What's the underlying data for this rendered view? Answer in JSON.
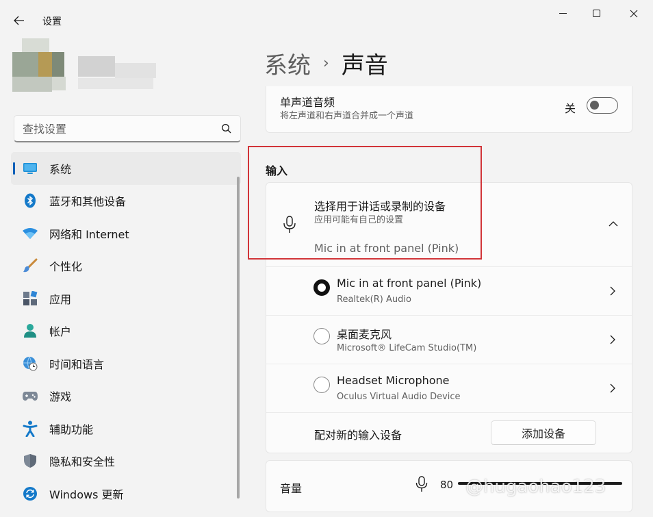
{
  "window": {
    "title": "设置"
  },
  "search": {
    "placeholder": "查找设置"
  },
  "sidebar": {
    "items": [
      {
        "label": "系统",
        "icon": "monitor-icon",
        "selected": true
      },
      {
        "label": "蓝牙和其他设备",
        "icon": "bluetooth-icon"
      },
      {
        "label": "网络和 Internet",
        "icon": "wifi-icon"
      },
      {
        "label": "个性化",
        "icon": "paintbrush-icon"
      },
      {
        "label": "应用",
        "icon": "apps-icon"
      },
      {
        "label": "帐户",
        "icon": "person-icon"
      },
      {
        "label": "时间和语言",
        "icon": "globe-clock-icon"
      },
      {
        "label": "游戏",
        "icon": "gamepad-icon"
      },
      {
        "label": "辅助功能",
        "icon": "accessibility-icon"
      },
      {
        "label": "隐私和安全性",
        "icon": "shield-icon"
      },
      {
        "label": "Windows 更新",
        "icon": "update-icon"
      }
    ]
  },
  "breadcrumb": {
    "parent": "系统",
    "separator": "›",
    "current": "声音"
  },
  "mono": {
    "title": "单声道音频",
    "subtitle": "将左声道和右声道合并成一个声道",
    "state": "关"
  },
  "input_section": {
    "title": "输入",
    "chooser": {
      "title": "选择用于讲话或录制的设备",
      "subtitle": "应用可能有自己的设置",
      "selected": "Mic in at front panel (Pink)"
    },
    "devices": [
      {
        "name": "Mic in at front panel (Pink)",
        "detail": "Realtek(R) Audio",
        "checked": true
      },
      {
        "name": "桌面麦克风",
        "detail": "Microsoft® LifeCam Studio(TM)",
        "checked": false
      },
      {
        "name": "Headset Microphone",
        "detail": "Oculus Virtual Audio Device",
        "checked": false
      }
    ],
    "pair_label": "配对新的输入设备",
    "add_button": "添加设备"
  },
  "volume": {
    "label": "音量",
    "value": "80"
  },
  "watermark": "@hugaohao123",
  "colors": {
    "accent": "#005fb8",
    "highlight": "#d13438"
  }
}
